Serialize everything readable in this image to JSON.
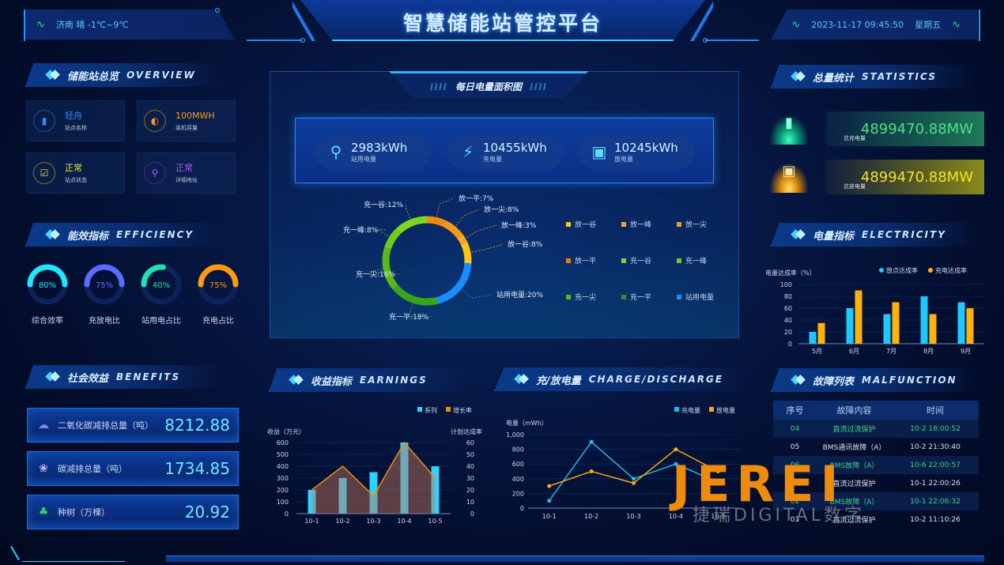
{
  "header": {
    "title": "智慧储能站管控平台",
    "weather": "济南 晴 -1℃~9℃",
    "datetime": "2023-11-17 09:45:50",
    "weekday": "星期五"
  },
  "overview": {
    "title_zh": "储能站总览",
    "title_en": "OVERVIEW",
    "cards": [
      {
        "value": "轻舟",
        "label": "站点名称",
        "icon": "building-icon",
        "color": "#2d8fff"
      },
      {
        "value": "100MWH",
        "label": "装机容量",
        "icon": "moon-icon",
        "color": "#ff9a1a"
      },
      {
        "value": "正常",
        "label": "站点状态",
        "icon": "check-icon",
        "color": "#e6e23a"
      },
      {
        "value": "正常",
        "label": "详细地址",
        "icon": "location-pin-icon",
        "color": "#a45cff"
      }
    ]
  },
  "efficiency": {
    "title_zh": "能效指标",
    "title_en": "EFFICIENCY",
    "gauges": [
      {
        "label": "综合效率",
        "value": 80,
        "text": "80%",
        "color": "#1ee6ff"
      },
      {
        "label": "充放电比",
        "value": 75,
        "text": "75%",
        "color": "#5a6bff"
      },
      {
        "label": "站用电占比",
        "value": 40,
        "text": "40%",
        "color": "#22e0b0"
      },
      {
        "label": "充电占比",
        "value": 75,
        "text": "75%",
        "color": "#ff9a10"
      }
    ]
  },
  "benefits": {
    "title_zh": "社会效益",
    "title_en": "BENEFITS",
    "items": [
      {
        "label": "二氧化碳减排总量（吨）",
        "value": "8212.88",
        "icon": "cloud-icon"
      },
      {
        "label": "碳减排总量（吨）",
        "value": "1734.85",
        "icon": "lotus-icon"
      },
      {
        "label": "种树（万棵）",
        "value": "20.92",
        "icon": "tree-icon"
      }
    ]
  },
  "center": {
    "title": "每日电量面积图",
    "kpis": [
      {
        "value": "2983kWh",
        "label": "站用电量",
        "icon": "bulb-icon"
      },
      {
        "value": "10455kWh",
        "label": "充电量",
        "icon": "battery-charging-icon"
      },
      {
        "value": "10245kWh",
        "label": "放电量",
        "icon": "battery-discharge-icon"
      }
    ]
  },
  "statistics": {
    "title_zh": "总量统计",
    "title_en": "STATISTICS",
    "items": [
      {
        "value": "4899470.88MW",
        "label": "总充电量",
        "color": "#4ee08a"
      },
      {
        "value": "4899470.88MW",
        "label": "总放电量",
        "color": "#f3e32a"
      }
    ]
  },
  "electricity": {
    "title_zh": "电量指标",
    "title_en": "ELECTRICITY"
  },
  "earnings": {
    "title_zh": "收益指标",
    "title_en": "EARNINGS"
  },
  "chargeDischarge": {
    "title_zh": "充/放电量",
    "title_en": "CHARGE/DISCHARGE"
  },
  "malfunction": {
    "title_zh": "故障列表",
    "title_en": "MALFUNCTION",
    "columns": [
      "序号",
      "故障内容",
      "时间"
    ],
    "rows": [
      {
        "no": "04",
        "content": "直流过流保护",
        "time": "10-2 18:00:52",
        "color": "green"
      },
      {
        "no": "05",
        "content": "BMS通讯故障（A）",
        "time": "10-2 21:30:40",
        "color": "white"
      },
      {
        "no": "06",
        "content": "BMS故障（A）",
        "time": "10-6 22:00:57",
        "color": "green"
      },
      {
        "no": "01",
        "content": "直流过流保护",
        "time": "10-1 22:00:26",
        "color": "white"
      },
      {
        "no": "02",
        "content": "BMS故障（A）",
        "time": "10-1 22:06:32",
        "color": "green"
      },
      {
        "no": "03",
        "content": "直流过流保护",
        "time": "10-2 11:10:26",
        "color": "white"
      }
    ]
  },
  "watermark": {
    "brand": "JEREI",
    "sub": "捷瑞DIGITAL数字"
  },
  "chart_data": [
    {
      "id": "daily-energy-donut",
      "type": "pie",
      "title": "每日电量面积图",
      "labels": [
        "放一平",
        "放一尖",
        "放一峰",
        "放一谷",
        "站用电量",
        "充一平",
        "充一尖",
        "充一峰",
        "充一谷"
      ],
      "values": [
        7,
        8,
        3,
        8,
        20,
        18,
        16,
        8,
        12
      ],
      "display": [
        "放一平:7%",
        "放一尖:8%",
        "放一峰:3%",
        "放一谷:8%",
        "站用电量:20%",
        "充一平:18%",
        "充一尖:16%",
        "充一峰:8%",
        "充一谷:12%"
      ],
      "colors": [
        "#f08a10",
        "#f59a18",
        "#f8a820",
        "#ffc414",
        "#1a8cff",
        "#3aa51a",
        "#58b818",
        "#6fcc1a",
        "#7fd620"
      ],
      "legend": [
        {
          "label": "放一谷",
          "color": "#ffc414"
        },
        {
          "label": "放一峰",
          "color": "#f8a820"
        },
        {
          "label": "放一尖",
          "color": "#f59a18"
        },
        {
          "label": "放一平",
          "color": "#e08210"
        },
        {
          "label": "充一谷",
          "color": "#7fd620"
        },
        {
          "label": "充一峰",
          "color": "#6fcc1a"
        },
        {
          "label": "充一尖",
          "color": "#58b818"
        },
        {
          "label": "充一平",
          "color": "#3a8f14"
        },
        {
          "label": "站用电量",
          "color": "#1a8cff"
        }
      ]
    },
    {
      "id": "electricity-bar",
      "type": "bar",
      "title": "",
      "ylabel": "电量达成率（%）",
      "categories": [
        "5月",
        "6月",
        "7月",
        "8月",
        "9月"
      ],
      "series": [
        {
          "name": "放点达成率",
          "values": [
            20,
            60,
            50,
            80,
            70
          ],
          "color": "#1ec8ff"
        },
        {
          "name": "充电达成率",
          "values": [
            35,
            90,
            70,
            50,
            60
          ],
          "color": "#ffb20a"
        }
      ],
      "ylim": [
        0,
        100
      ],
      "yticks": [
        0,
        20,
        40,
        60,
        80,
        100
      ],
      "legend": "top-right"
    },
    {
      "id": "earnings-combo",
      "type": "bar",
      "ylabel": "收益（万元）",
      "y2label": "计划达成率",
      "categories": [
        "10-1",
        "10-2",
        "10-3",
        "10-4",
        "10-5"
      ],
      "series": [
        {
          "name": "系列",
          "type": "bar",
          "values": [
            200,
            300,
            350,
            600,
            400
          ],
          "color": "#2ad4ff"
        },
        {
          "name": "增长率",
          "type": "area",
          "axis": "right",
          "values": [
            20,
            40,
            15,
            60,
            30
          ],
          "color": "#f08a10"
        }
      ],
      "ylim": [
        0,
        600
      ],
      "yticks": [
        0,
        100,
        200,
        300,
        400,
        500,
        600
      ],
      "y2lim": [
        0,
        60
      ],
      "y2ticks": [
        0,
        10,
        20,
        30,
        40,
        50,
        60
      ],
      "legend": "top-right"
    },
    {
      "id": "charge-discharge-line",
      "type": "line",
      "ylabel": "电量（mWh）",
      "categories": [
        "10-1",
        "10-2",
        "10-3",
        "10-4",
        "10-5"
      ],
      "series": [
        {
          "name": "充电量",
          "values": [
            100,
            900,
            400,
            600,
            350
          ],
          "color": "#22b8f0"
        },
        {
          "name": "放电量",
          "values": [
            300,
            500,
            340,
            800,
            500
          ],
          "color": "#f5aa10"
        }
      ],
      "ylim": [
        0,
        1000
      ],
      "yticks": [
        "0",
        "200",
        "400",
        "600",
        "800",
        "1,000"
      ],
      "legend": "top-right"
    }
  ]
}
